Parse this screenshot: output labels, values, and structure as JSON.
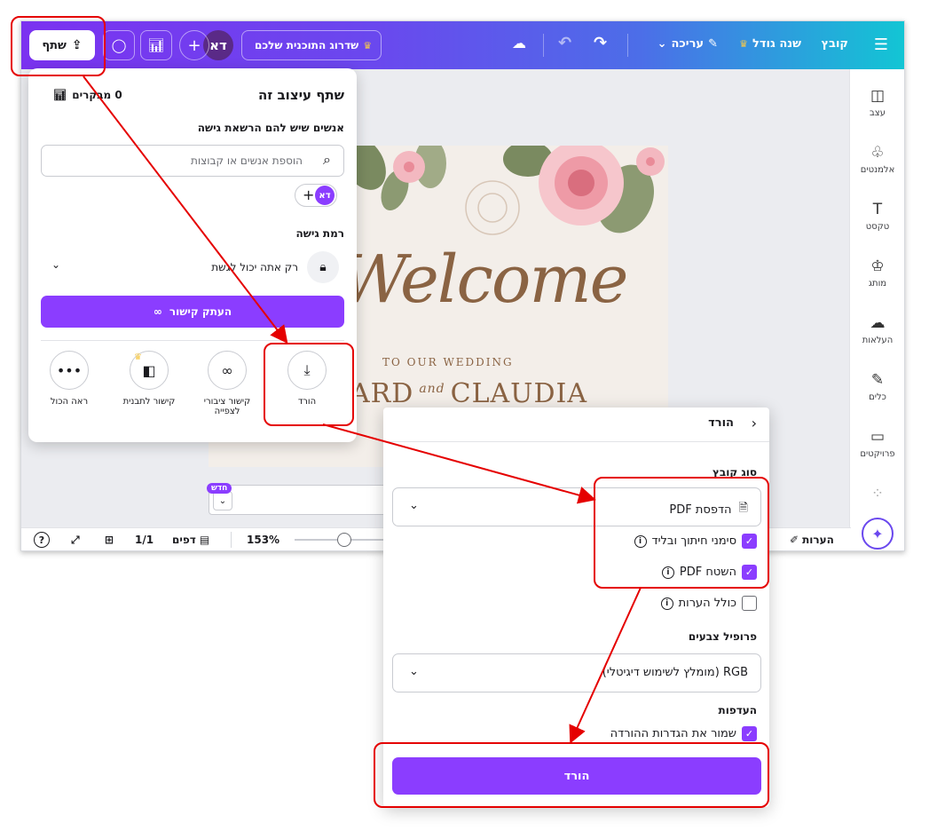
{
  "topbar": {
    "menu": "☰",
    "file": "קובץ",
    "resize": "שנה גודל",
    "edit": "עריכה",
    "upgrade": "שדרוג התוכנית שלכם",
    "avatar": "דא",
    "plus": "+",
    "share": "שתף"
  },
  "sidebar": {
    "items": [
      {
        "label": "עצב",
        "icon": "◫"
      },
      {
        "label": "אלמנטים",
        "icon": "♧"
      },
      {
        "label": "טקסט",
        "icon": "T"
      },
      {
        "label": "מותג",
        "icon": "♔"
      },
      {
        "label": "העלאות",
        "icon": "☁"
      },
      {
        "label": "כלים",
        "icon": "✎"
      },
      {
        "label": "פרויקטים",
        "icon": "▭"
      },
      {
        "label": "",
        "icon": "⁘"
      }
    ]
  },
  "design": {
    "welcome": "Welcome",
    "subtitle": "TO OUR WEDDING",
    "name_left": "ARD",
    "and": "and",
    "name_right": "CLAUDIA"
  },
  "badge_new": "חדש",
  "bottombar": {
    "help": "?",
    "pagecount": "1/1",
    "pages": "דפים",
    "zoom": "153%",
    "notes": "הערות"
  },
  "share_panel": {
    "title": "שתף עיצוב זה",
    "viewers": "0 מבקרים",
    "people_label": "אנשים שיש להם הרשאת גישה",
    "search_placeholder": "הוספת אנשים או קבוצות",
    "mini_avatar": "דא",
    "access_label": "רמת גישה",
    "access_value": "רק אתה יכול לגשת",
    "copy_link": "העתק קישור",
    "options": [
      {
        "label": "הורד",
        "icon": "⤓"
      },
      {
        "label": "קישור ציבורי לצפייה",
        "icon": "∞"
      },
      {
        "label": "קישור לתבנית",
        "icon": "◧"
      },
      {
        "label": "ראה הכול",
        "icon": "•••"
      }
    ]
  },
  "download_panel": {
    "back": "‹",
    "title": "הורד",
    "file_type_label": "סוג קובץ",
    "file_type_value": "הדפסת PDF",
    "check_crop": "סימני חיתוך ובליד",
    "check_flatten": "השטח PDF",
    "check_notes": "כולל הערות",
    "color_profile_label": "פרופיל צבעים",
    "color_profile_value": "RGB (מומלץ לשימוש דיגיטלי)",
    "prefs_label": "העדפות",
    "check_save": "שמור את הגדרות ההורדה",
    "download_button": "הורד"
  },
  "colors": {
    "accent": "#8b3dff",
    "annotation": "#e50000"
  }
}
